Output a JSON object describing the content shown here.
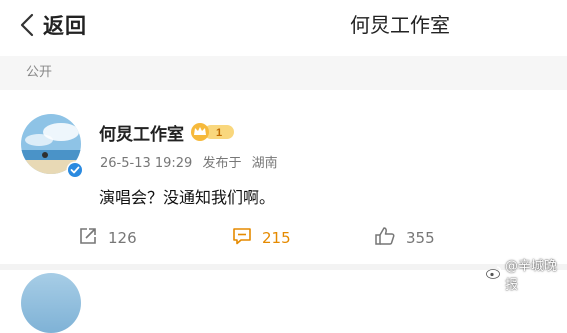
{
  "header": {
    "back_label": "返回",
    "title": "何炅工作室"
  },
  "section": {
    "label": "公开"
  },
  "post": {
    "username": "何炅工作室",
    "vip_level": "1",
    "date": "26-5-13 19:29",
    "source": "发布于",
    "location": "湖南",
    "text": "演唱会？没通知我们啊。",
    "repost_count": "126",
    "comment_count": "215",
    "like_count": "355"
  },
  "watermark": "@辛城晚报",
  "colors": {
    "accent": "#e58a00",
    "verified": "#2a8ae0",
    "text": "#222222",
    "muted": "#777777"
  }
}
